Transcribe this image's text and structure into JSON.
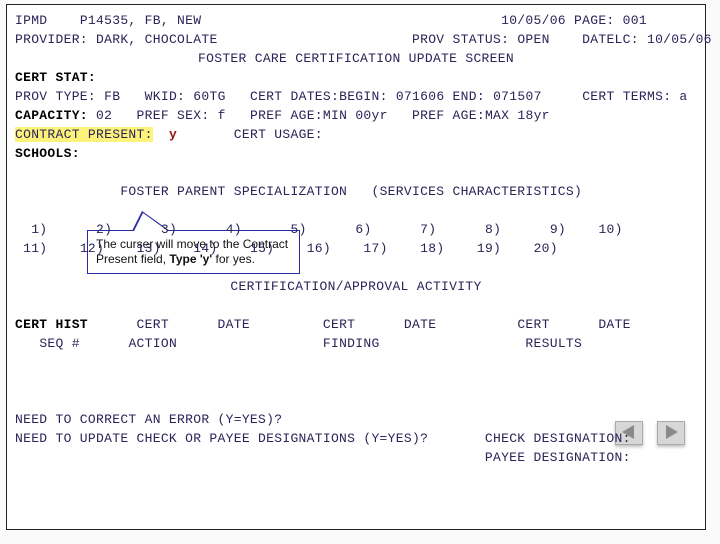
{
  "hdr": {
    "code": "IPMD",
    "acct": "P14535",
    "suffix": ", FB, NEW",
    "date": "10/05/06",
    "page_lbl": "PAGE:",
    "page": "001"
  },
  "line2": {
    "prov_lbl": "PROVIDER:",
    "prov": "DARK, CHOCOLATE",
    "status_lbl": "PROV STATUS:",
    "status": "OPEN",
    "datelc_lbl": "DATELC:",
    "datelc": "10/05/06"
  },
  "title": "FOSTER CARE CERTIFICATION UPDATE SCREEN",
  "cert_stat_lbl": "CERT STAT:",
  "line5": {
    "prov_type_lbl": "PROV TYPE:",
    "prov_type": "FB",
    "wkid_lbl": "WKID:",
    "wkid": "60TG",
    "cert_dates_lbl": "CERT DATES:BEGIN:",
    "begin": "071606",
    "end_lbl": "END:",
    "end": "071507",
    "cert_terms_lbl": "CERT TERMS:",
    "cert_terms": "a"
  },
  "line6": {
    "cap_lbl": "CAPACITY:",
    "cap": "02",
    "psex_lbl": "PREF SEX:",
    "psex": "f",
    "page_lbl": "PREF AGE:MIN",
    "pmin": "00yr",
    "page_lbl2": "PREF AGE:MAX",
    "pmax": "18yr"
  },
  "line7": {
    "cp_lbl": "CONTRACT PRESENT:",
    "cp_val": "y",
    "cu_lbl": "CERT USAGE:"
  },
  "schools_lbl": "SCHOOLS:",
  "spec_title": "FOSTER PARENT SPECIALIZATION   (SERVICES CHARACTERISTICS)",
  "grid": {
    "r1": [
      " 1)",
      " 2)",
      " 3)",
      " 4)",
      " 5)",
      " 6)",
      " 7)",
      " 8)",
      " 9)",
      "10)"
    ],
    "r2": [
      "11)",
      "12)",
      "13)",
      "14)",
      "15)",
      "16)",
      "17)",
      "18)",
      "19)",
      "20)"
    ]
  },
  "activity_title": "CERTIFICATION/APPROVAL ACTIVITY",
  "cols": {
    "a1": "CERT HIST",
    "a2": "SEQ #",
    "b1": "CERT",
    "b2": "ACTION",
    "c1": "DATE",
    "d1": "CERT",
    "d2": "FINDING",
    "e1": "DATE",
    "f1": "CERT",
    "f2": "RESULTS",
    "g1": "DATE"
  },
  "q1": "NEED TO CORRECT AN ERROR (Y=YES)?",
  "q2": "NEED TO UPDATE CHECK OR PAYEE DESIGNATIONS (Y=YES)?",
  "desig": {
    "check": "CHECK DESIGNATION:",
    "payee": "PAYEE DESIGNATION:"
  },
  "callout": {
    "t1": "The curser will move to the Contract Present field, ",
    "t2": "Type 'y'",
    "t3": " for yes."
  },
  "icons": {
    "prev": "nav-prev-icon",
    "next": "nav-next-icon"
  }
}
